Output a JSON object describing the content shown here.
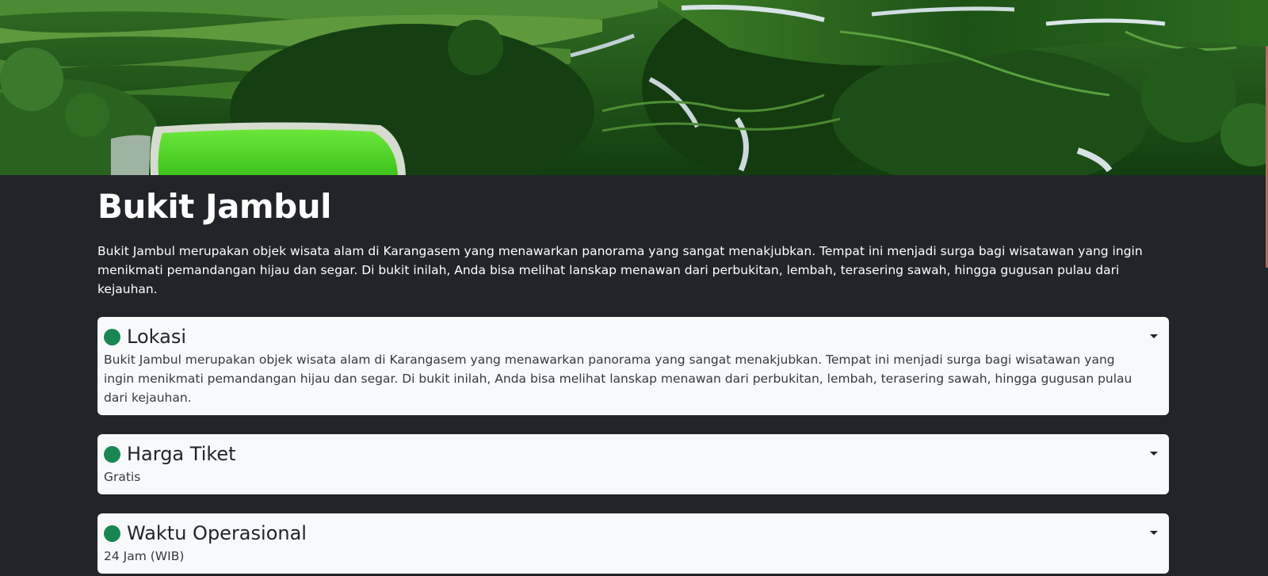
{
  "hero": {
    "image_description": "rice-terrace-landscape-photo"
  },
  "page": {
    "title": "Bukit Jambul",
    "intro": "Bukit Jambul merupakan objek wisata alam di Karangasem yang menawarkan panorama yang sangat menakjubkan. Tempat ini menjadi surga bagi wisatawan yang ingin menikmati pemandangan hijau dan segar. Di bukit inilah, Anda bisa melihat lanskap menawan dari perbukitan, lembah, terasering sawah, hingga gugusan pulau dari kejauhan."
  },
  "cards": [
    {
      "title": "Lokasi",
      "body": "Bukit Jambul merupakan objek wisata alam di Karangasem yang menawarkan panorama yang sangat menakjubkan. Tempat ini menjadi surga bagi wisatawan yang ingin menikmati pemandangan hijau dan segar. Di bukit inilah, Anda bisa melihat lanskap menawan dari perbukitan, lembah, terasering sawah, hingga gugusan pulau dari kejauhan."
    },
    {
      "title": "Harga Tiket",
      "body": "Gratis"
    },
    {
      "title": "Waktu Operasional",
      "body": "24 Jam (WIB)"
    }
  ],
  "colors": {
    "background": "#212529",
    "card": "#f8f9fa",
    "dot": "#198754",
    "text_light": "#ffffff",
    "text_dark": "#212529"
  },
  "icons": {
    "status": "green-dot-icon",
    "toggle": "caret-down-icon"
  }
}
